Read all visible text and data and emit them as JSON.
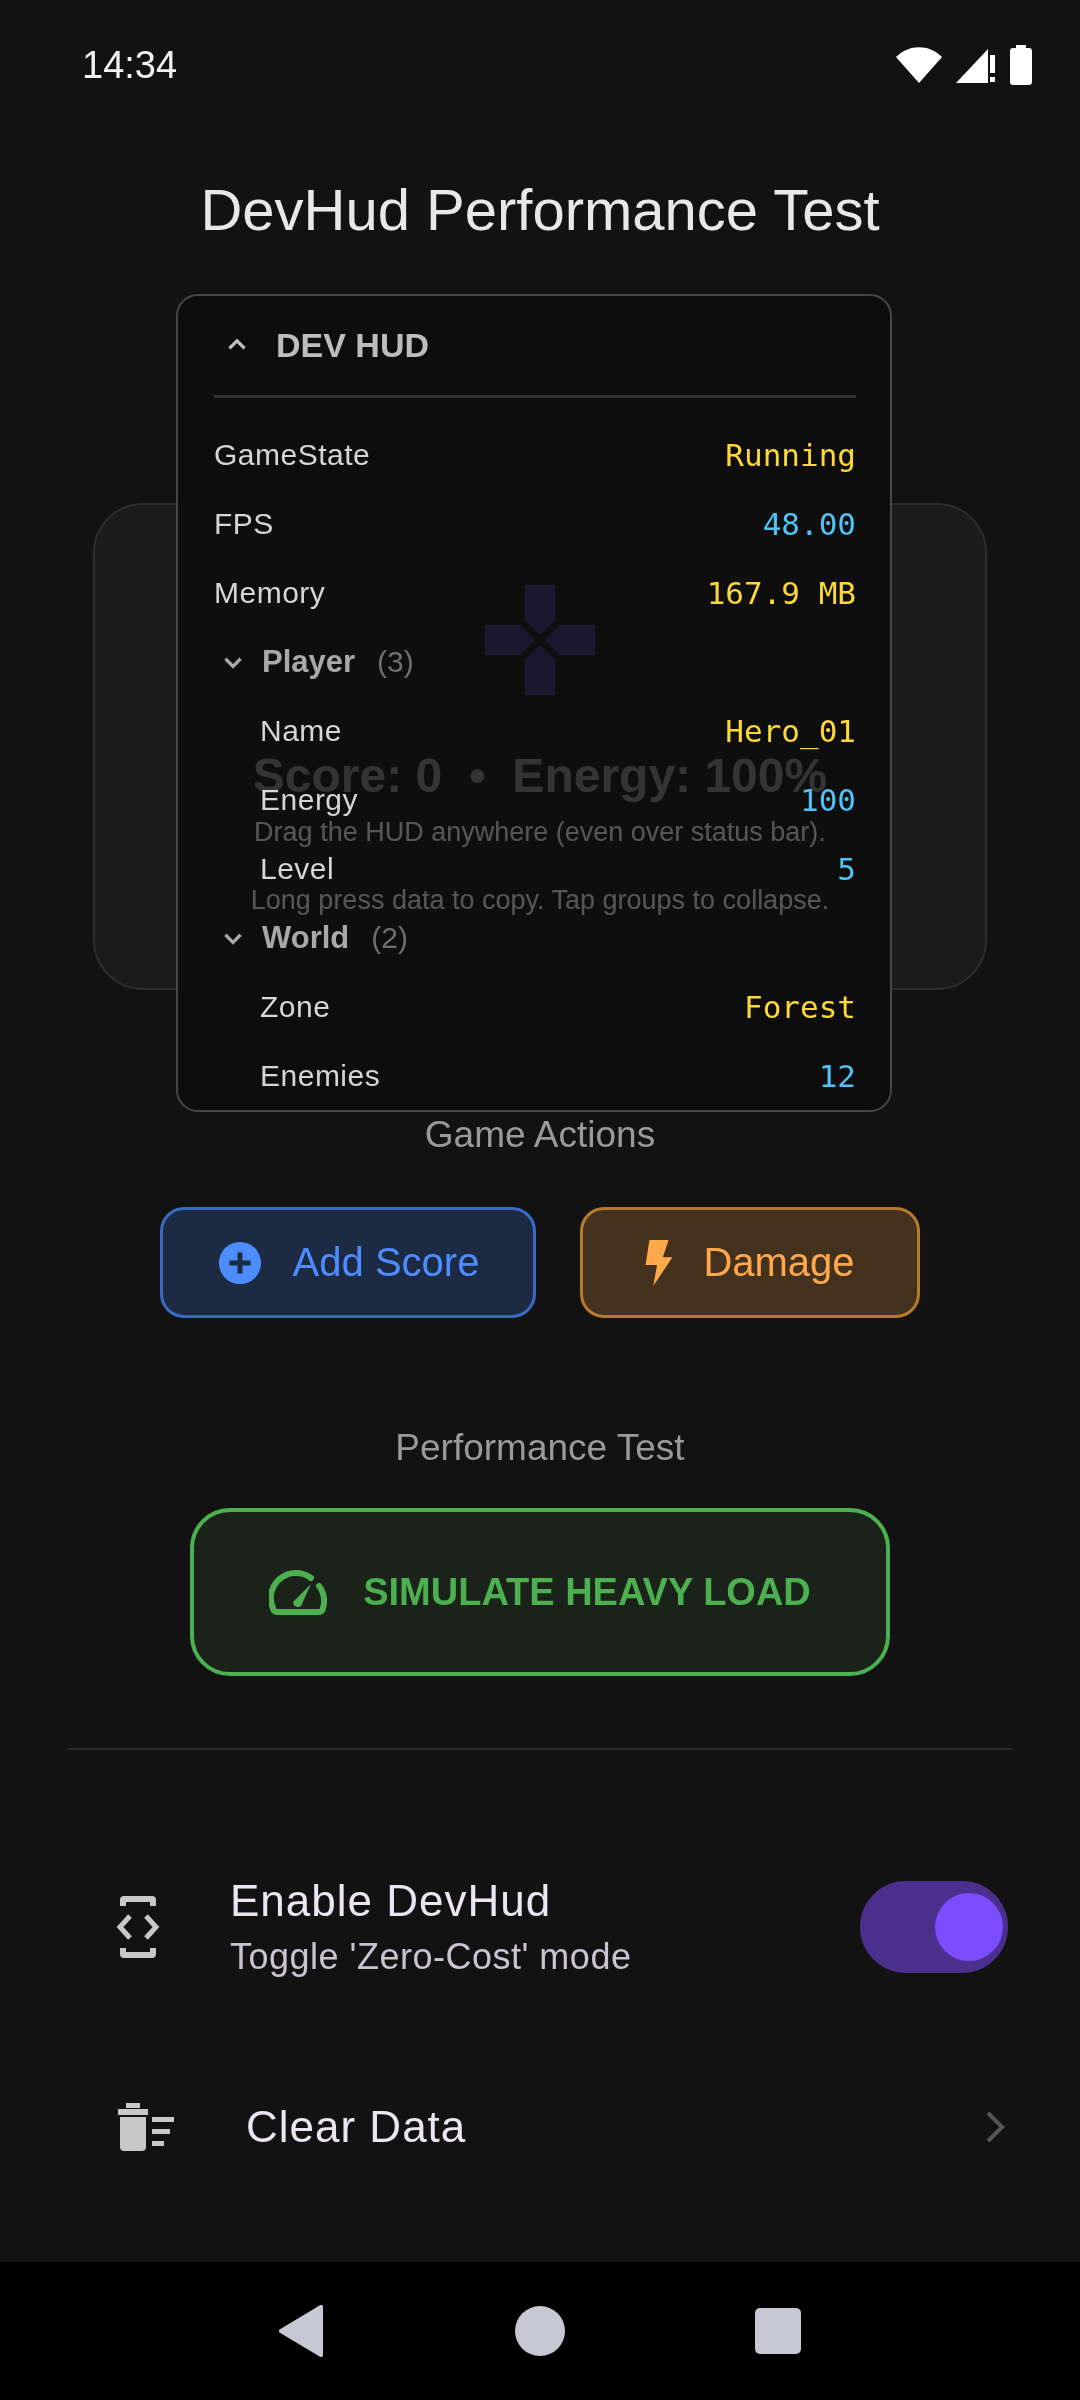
{
  "status_bar": {
    "time": "14:34"
  },
  "title": "DevHud Performance Test",
  "game_card": {
    "score": "Score: 0  •  Energy: 100%",
    "hints": [
      "Drag the HUD anywhere (even over status bar).",
      "Long press data to copy. Tap groups to collapse."
    ]
  },
  "actions_heading": "Game Actions",
  "actions": [
    {
      "kind": "add",
      "label": "Add Score"
    },
    {
      "kind": "damage",
      "label": "Damage"
    }
  ],
  "performance": {
    "heading": "Performance Test",
    "button": "SIMULATE HEAVY LOAD"
  },
  "settings": [
    {
      "kind": "toggle",
      "title": "Enable DevHud",
      "subtitle": "Toggle 'Zero-Cost' mode",
      "on": true
    },
    {
      "kind": "link",
      "title": "Clear Data"
    }
  ],
  "hud": {
    "title": "DEV HUD",
    "expanded": true,
    "items": [
      {
        "kind": "entry",
        "label": "GameState",
        "value": "Running",
        "color": "#fdd835"
      },
      {
        "kind": "entry",
        "label": "FPS",
        "value": "48.00",
        "color": "#4fc3f7"
      },
      {
        "kind": "entry",
        "label": "Memory",
        "value": "167.9 MB",
        "color": "#fdd835"
      },
      {
        "kind": "group",
        "name": "Player",
        "count": "(3)",
        "expanded": true,
        "children": [
          {
            "label": "Name",
            "value": "Hero_01",
            "color": "#fdd835"
          },
          {
            "label": "Energy",
            "value": "100",
            "color": "#4fc3f7"
          },
          {
            "label": "Level",
            "value": "5",
            "color": "#4fc3f7"
          }
        ]
      },
      {
        "kind": "group",
        "name": "World",
        "count": "(2)",
        "expanded": true,
        "children": [
          {
            "label": "Zone",
            "value": "Forest",
            "color": "#fdd835"
          },
          {
            "label": "Enemies",
            "value": "12",
            "color": "#4fc3f7"
          }
        ]
      }
    ]
  }
}
